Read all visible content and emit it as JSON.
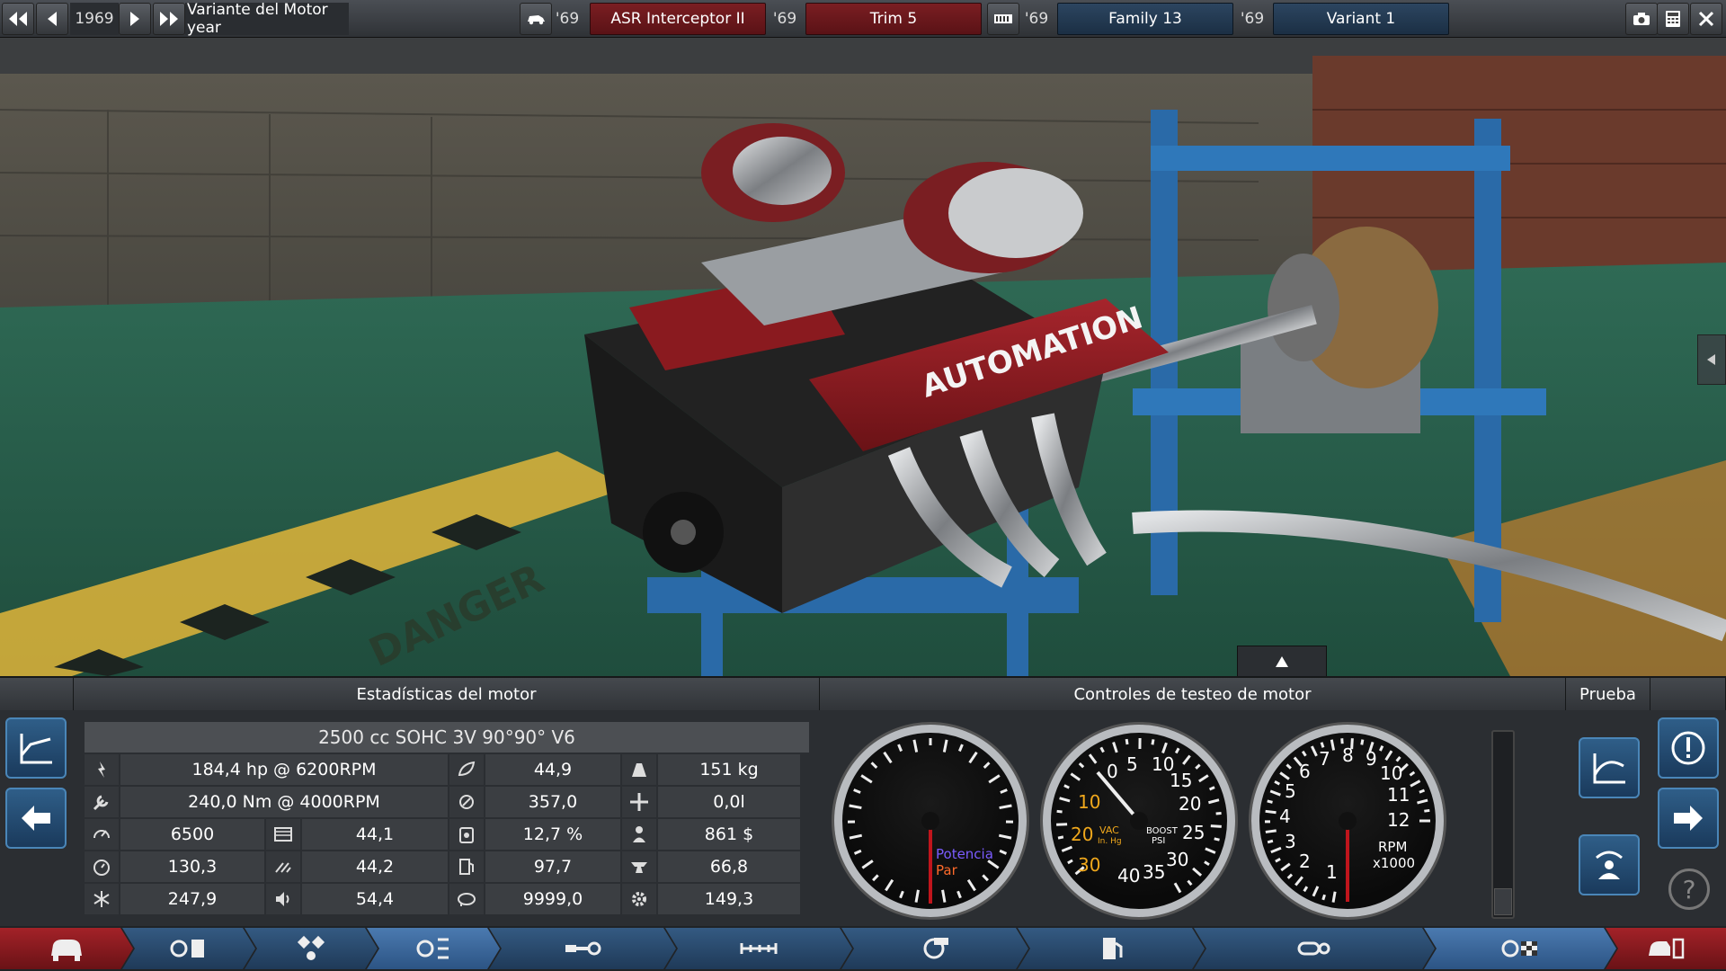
{
  "topbar": {
    "year": "1969",
    "variant_year_label": "Variante del Motor year",
    "year_short_1": "'69",
    "car_name": "ASR Interceptor II",
    "year_short_2": "'69",
    "trim": "Trim 5",
    "year_short_3": "'69",
    "family": "Family 13",
    "year_short_4": "'69",
    "variant": "Variant 1"
  },
  "scene": {
    "logo_text": "AUTOMATION",
    "floor_text": "DANGER"
  },
  "stats": {
    "header": "Estadísticas del motor",
    "engine_title": "2500 cc SOHC 3V 90°90° V6",
    "rows": [
      {
        "a": "184,4 hp @ 6200RPM",
        "b": "44,9",
        "c": "151 kg"
      },
      {
        "a": "240,0 Nm @ 4000RPM",
        "b": "357,0",
        "c": "0,0l"
      },
      {
        "a": "6500",
        "a2": "44,1",
        "b": "12,7 %",
        "c": "861 $"
      },
      {
        "a": "130,3",
        "a2": "44,2",
        "b": "97,7",
        "c": "66,8"
      },
      {
        "a": "247,9",
        "a2": "54,4",
        "b": "9999,0",
        "c": "149,3"
      }
    ]
  },
  "test": {
    "header": "Controles de testeo de motor",
    "gauge1": {
      "label1": "Potencia",
      "label2": "Par",
      "label1_color": "#7b5cff",
      "label2_color": "#ff6a2a"
    },
    "gauge2": {
      "vac_label": "VAC",
      "vac_unit": "In. Hg",
      "boost_label": "BOOST",
      "boost_unit": "PSI",
      "vac_ticks": [
        "10",
        "20",
        "30"
      ],
      "boost_ticks": [
        "0",
        "5",
        "10",
        "15",
        "20",
        "25",
        "30",
        "35",
        "40"
      ]
    },
    "gauge3": {
      "ticks": [
        "1",
        "2",
        "3",
        "4",
        "5",
        "6",
        "7",
        "8",
        "9",
        "10",
        "11",
        "12"
      ],
      "label": "RPM",
      "unit": "x1000"
    }
  },
  "prueba": {
    "header": "Prueba"
  },
  "colors": {
    "accent_blue": "#2a6aa8",
    "accent_red": "#8b1a1f",
    "amber": "#f0a81c"
  }
}
